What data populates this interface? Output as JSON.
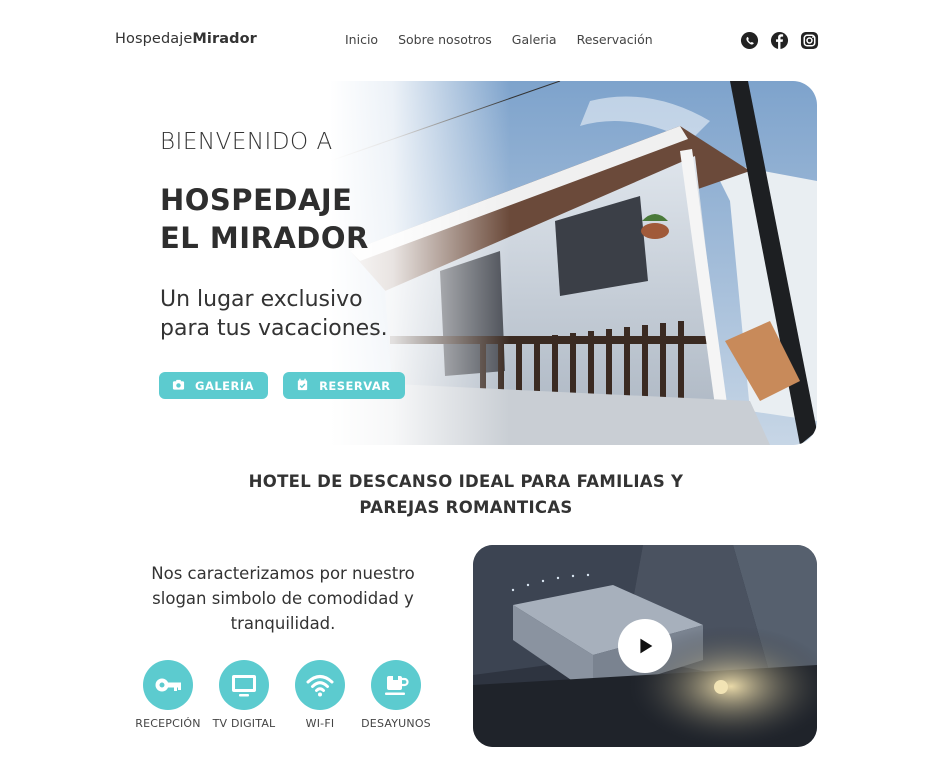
{
  "header": {
    "logo_light": "Hospedaje",
    "logo_bold": "Mirador",
    "nav": [
      "Inicio",
      "Sobre nosotros",
      "Galeria",
      "Reservación"
    ],
    "social_icons": [
      "whatsapp-icon",
      "facebook-icon",
      "instagram-icon"
    ]
  },
  "hero": {
    "pre_title": "BIENVENIDO A",
    "title_line1": "HOSPEDAJE",
    "title_line2": "EL MIRADOR",
    "subtitle_line1": "Un lugar exclusivo",
    "subtitle_line2": "para tus vacaciones.",
    "btn_gallery": "GALERÍA",
    "btn_reserve": "RESERVAR"
  },
  "tagline": {
    "line1": "HOTEL DE DESCANSO IDEAL PARA FAMILIAS Y",
    "line2": "PAREJAS ROMANTICAS"
  },
  "intro": {
    "line1": "Nos caracterizamos por nuestro",
    "line2": "slogan simbolo de comodidad y",
    "line3": "tranquilidad."
  },
  "features": [
    {
      "label": "RECEPCIÓN",
      "icon": "key-icon"
    },
    {
      "label": "TV DIGITAL",
      "icon": "tv-icon"
    },
    {
      "label": "WI-FI",
      "icon": "wifi-icon"
    },
    {
      "label": "DESAYUNOS",
      "icon": "coffee-cup-icon"
    }
  ],
  "colors": {
    "accent": "#5ccbcf",
    "text": "#333333"
  }
}
